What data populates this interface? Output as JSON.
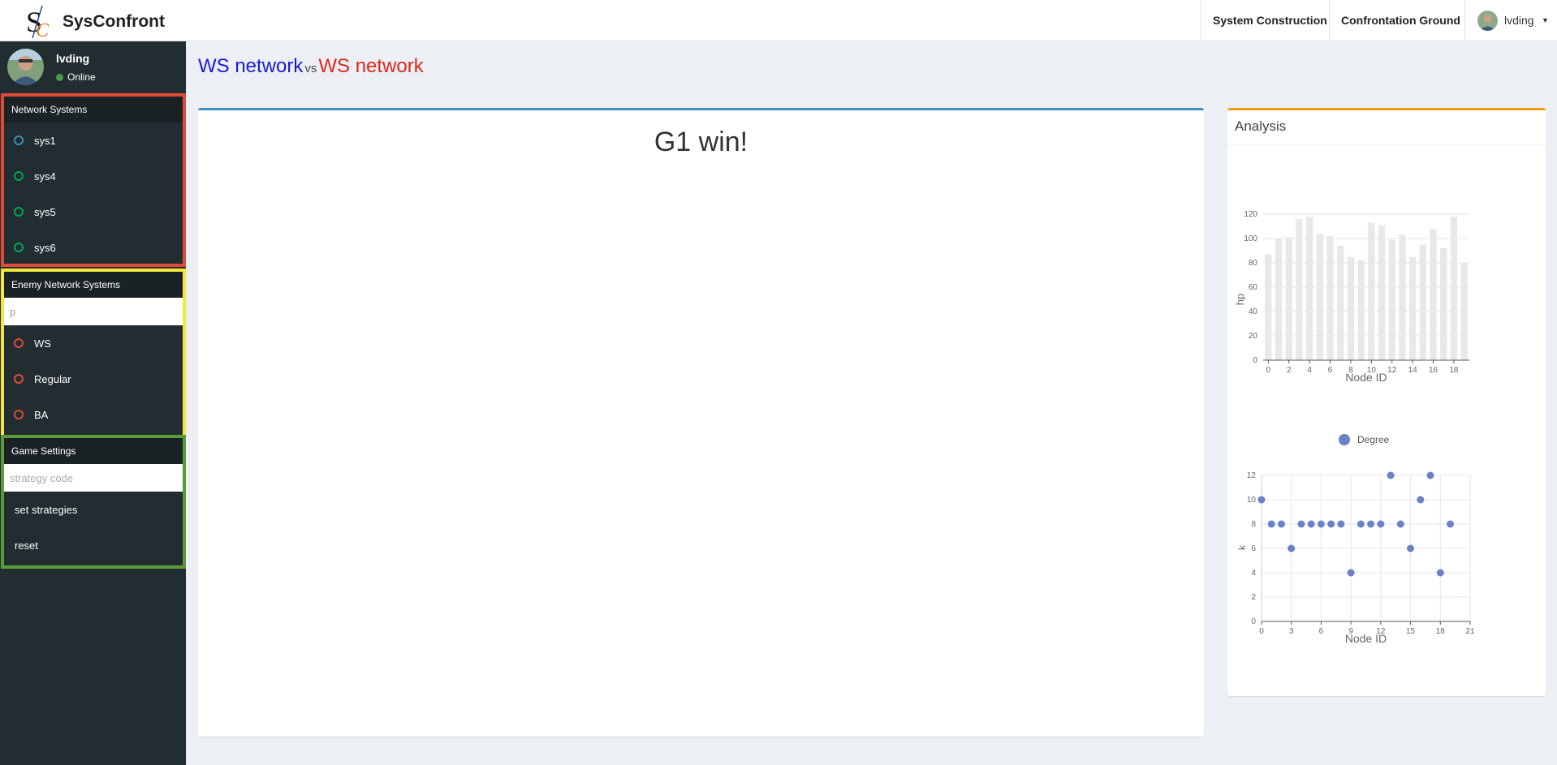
{
  "navbar": {
    "brand": "SysConfront",
    "menu": [
      "System Construction",
      "Confrontation Ground"
    ],
    "user": "lvding"
  },
  "sidebar": {
    "user": {
      "name": "lvding",
      "status": "Online"
    },
    "network_systems": {
      "header": "Network Systems",
      "items": [
        {
          "label": "sys1",
          "color": "#3c8dbc"
        },
        {
          "label": "sys4",
          "color": "#00a65a"
        },
        {
          "label": "sys5",
          "color": "#00a65a"
        },
        {
          "label": "sys6",
          "color": "#00a65a"
        }
      ],
      "border_color": "#dd4b39"
    },
    "enemy_systems": {
      "header": "Enemy Network Systems",
      "input_value": "p",
      "items": [
        {
          "label": "WS",
          "color": "#dd4b39"
        },
        {
          "label": "Regular",
          "color": "#dd4b39"
        },
        {
          "label": "BA",
          "color": "#dd4b39"
        }
      ],
      "border_color": "#f5e83a"
    },
    "game_settings": {
      "header": "Game Settings",
      "input_placeholder": "strategy code",
      "buttons": [
        "set strategies",
        "reset"
      ],
      "border_color": "#5b9a3a"
    }
  },
  "title": {
    "g1": "WS network",
    "vs": "vs",
    "g2": "WS network"
  },
  "main": {
    "result": "G1 win!"
  },
  "analysis": {
    "header": "Analysis",
    "chart_data": [
      {
        "type": "bar",
        "ylabel": "hp",
        "xlabel": "Node ID",
        "ylim": [
          0,
          120
        ],
        "yticks": [
          0,
          20,
          40,
          60,
          80,
          100,
          120
        ],
        "xticks": [
          0,
          2,
          4,
          6,
          8,
          10,
          12,
          14,
          16,
          18
        ],
        "categories": [
          0,
          1,
          2,
          3,
          4,
          5,
          6,
          7,
          8,
          9,
          10,
          11,
          12,
          13,
          14,
          15,
          16,
          17,
          18,
          19
        ],
        "values": [
          87,
          100,
          101,
          116,
          118,
          104,
          102,
          94,
          85,
          82,
          113,
          111,
          99,
          103,
          85,
          95,
          108,
          92,
          118,
          80
        ],
        "color": "#e8e8e8"
      },
      {
        "type": "scatter",
        "legend": "Degree",
        "ylabel": "k",
        "xlabel": "Node ID",
        "xlim": [
          0,
          21
        ],
        "ylim": [
          0,
          12
        ],
        "xticks": [
          0,
          3,
          6,
          9,
          12,
          15,
          18,
          21
        ],
        "yticks": [
          0,
          2,
          4,
          6,
          8,
          10,
          12
        ],
        "x": [
          0,
          1,
          2,
          3,
          4,
          5,
          6,
          7,
          8,
          9,
          10,
          11,
          12,
          13,
          14,
          15,
          16,
          17,
          18,
          19
        ],
        "y": [
          10,
          8,
          8,
          6,
          8,
          8,
          8,
          8,
          8,
          4,
          8,
          8,
          8,
          12,
          8,
          6,
          10,
          12,
          4,
          8
        ],
        "color": "#6b82c8"
      }
    ]
  }
}
